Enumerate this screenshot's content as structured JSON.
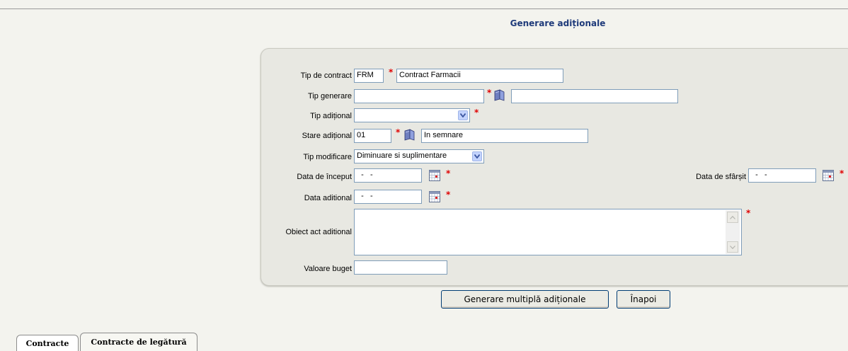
{
  "page": {
    "title": "Generare adiționale"
  },
  "form": {
    "tip_contract": {
      "label": "Tip de contract",
      "code": "FRM",
      "name": "Contract Farmacii"
    },
    "tip_generare": {
      "label": "Tip generare",
      "code": "",
      "name": ""
    },
    "tip_aditional": {
      "label": "Tip adițional",
      "value": ""
    },
    "stare_aditional": {
      "label": "Stare adițional",
      "code": "01",
      "name": "In semnare"
    },
    "tip_modificare": {
      "label": "Tip modificare",
      "value": "Diminuare si suplimentare"
    },
    "data_inceput": {
      "label": "Data de început",
      "value": "  -   -"
    },
    "data_sfarsit": {
      "label": "Data de sfârșit",
      "value": "  -   -"
    },
    "data_aditional": {
      "label": "Data aditional",
      "value": "  -   -"
    },
    "obiect_act": {
      "label": "Obiect act aditional",
      "value": ""
    },
    "valoare_buget": {
      "label": "Valoare buget",
      "value": ""
    },
    "required_mark": "*"
  },
  "buttons": {
    "generate": "Generare multiplă adiționale",
    "back": "Înapoi"
  },
  "tabs": [
    {
      "label": "Contracte"
    },
    {
      "label": "Contracte de legătură"
    }
  ],
  "colors": {
    "title": "#1e3a7a",
    "required": "#e00000",
    "input_border": "#7f9db9"
  }
}
